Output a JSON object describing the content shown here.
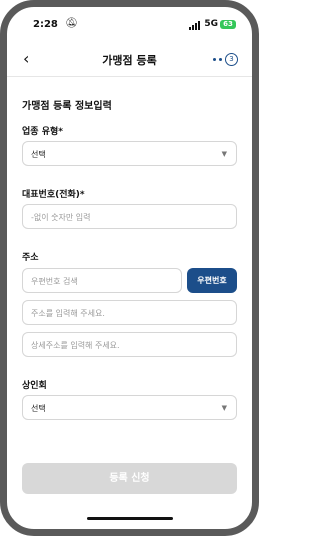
{
  "status": {
    "time": "2:28",
    "network": "5G",
    "battery": "63"
  },
  "header": {
    "back_icon": "chevron-left-icon",
    "title": "가맹점 등록",
    "step": "3"
  },
  "form": {
    "heading": "가맹점 등록 정보입력",
    "business_type": {
      "label": "업종 유형*",
      "value": "선택"
    },
    "phone": {
      "label": "대표번호(전화)*",
      "placeholder": "-없이 숫자만 입력"
    },
    "address": {
      "label": "주소",
      "zip_placeholder": "우편번호 검색",
      "zip_button": "우편번호",
      "addr1_placeholder": "주소를 입력해 주세요.",
      "addr2_placeholder": "상세주소를 입력해 주세요."
    },
    "merchant_assoc": {
      "label": "상인회",
      "value": "선택"
    }
  },
  "submit": {
    "label": "등록 신청",
    "enabled": false
  },
  "colors": {
    "accent": "#1c4e8a",
    "disabled": "#d8d8d8",
    "battery": "#34c759"
  }
}
